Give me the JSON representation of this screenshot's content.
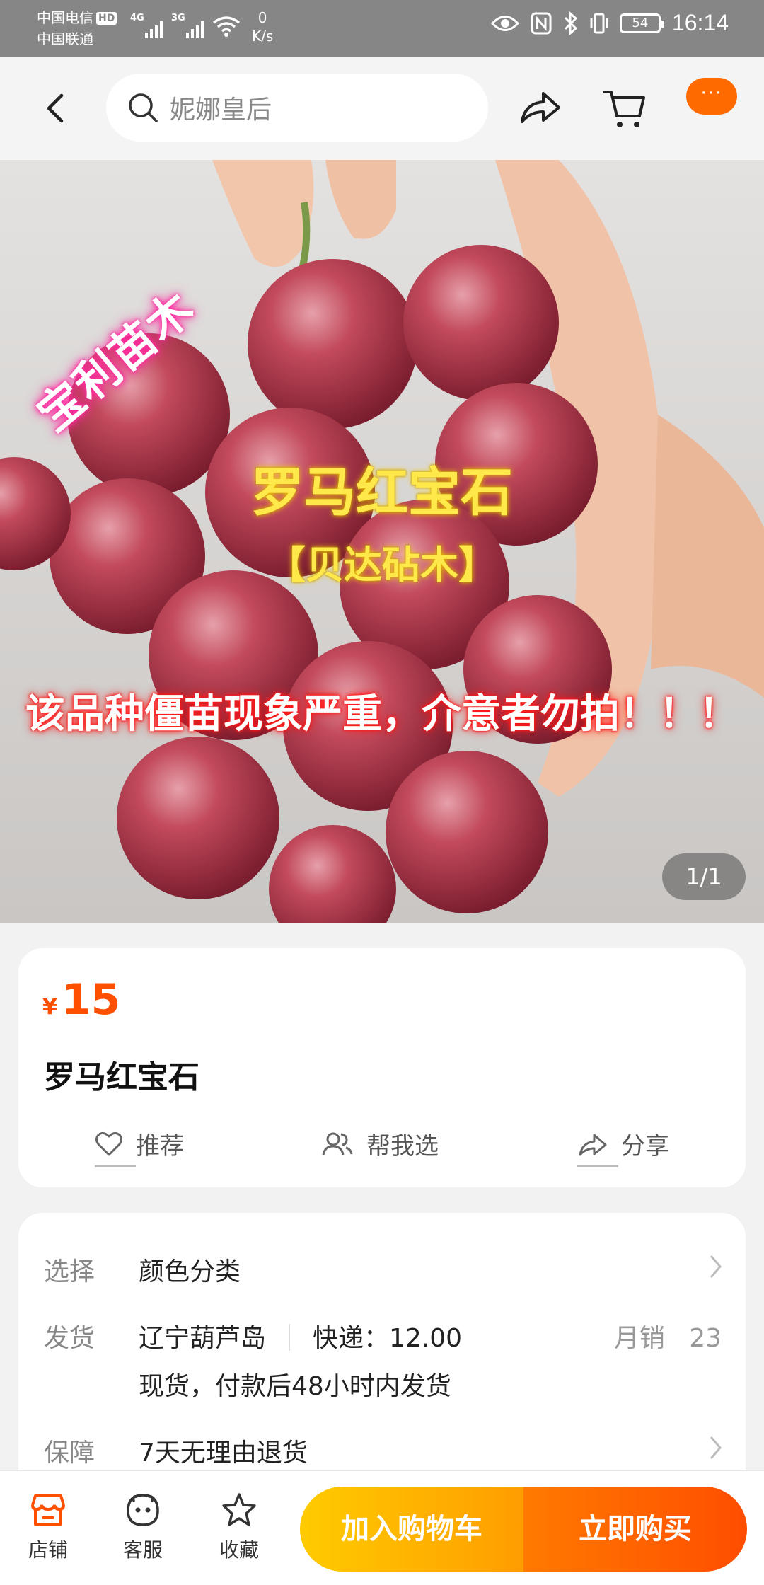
{
  "status_bar": {
    "carrier1": "中国电信",
    "carrier1_badge": "HD",
    "carrier2": "中国联通",
    "net1": "4G",
    "net2": "3G",
    "speed_value": "0",
    "speed_unit": "K/s",
    "battery": "54",
    "time": "16:14"
  },
  "nav": {
    "search_placeholder": "妮娜皇后",
    "more_label": "···"
  },
  "hero": {
    "watermark": "宝利苗木",
    "title": "罗马红宝石",
    "subtitle": "【贝达砧木】",
    "warning": "该品种僵苗现象严重，介意者勿拍！！！",
    "page_indicator": "1/1"
  },
  "product": {
    "currency": "¥",
    "price": "15",
    "title": "罗马红宝石",
    "actions": {
      "recommend": "推荐",
      "help_choose": "帮我选",
      "share": "分享"
    }
  },
  "info": {
    "select_label": "选择",
    "select_value": "颜色分类",
    "ship_label": "发货",
    "ship_origin": "辽宁葫芦岛",
    "ship_express": "快递：12.00",
    "ship_sales_label": "月销",
    "ship_sales_value": "23",
    "ship_note": "现货，付款后48小时内发货",
    "guarantee_label": "保障",
    "guarantee_value": "7天无理由退货"
  },
  "bottom": {
    "store": "店铺",
    "service": "客服",
    "favorite": "收藏",
    "add_cart": "加入购物车",
    "buy_now": "立即购买"
  },
  "colors": {
    "accent": "#ff5000",
    "cart_button": "#ffb300",
    "buy_button": "#ff5a00"
  }
}
